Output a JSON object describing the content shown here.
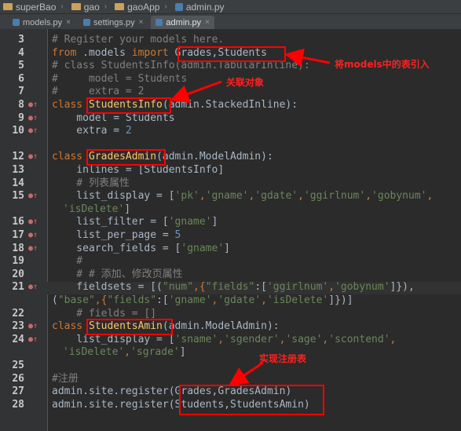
{
  "breadcrumb": [
    "superBao",
    "gao",
    "gaoApp",
    "admin.py"
  ],
  "tabs": [
    {
      "label": "models.py",
      "active": false
    },
    {
      "label": "settings.py",
      "active": false
    },
    {
      "label": "admin.py",
      "active": true
    }
  ],
  "annotations": {
    "import_models": "将models中的表引入",
    "related_object": "关联对象",
    "register_tables": "实现注册表"
  },
  "code": {
    "l3": "# Register your models here.",
    "l4a": "from",
    "l4b": " .models ",
    "l4c": "import",
    "l4d": " Grades,Students",
    "l5": "# class StudentsInfo(admin.TabularInline):",
    "l6": "#     model = Students",
    "l7": "#     extra = 2",
    "l8a": "class ",
    "l8b": "StudentsInfo",
    "l8c": "(admin.StackedInline):",
    "l9": "    model = Students",
    "l10a": "    extra = ",
    "l10b": "2",
    "l12a": "class ",
    "l12b": "GradesAdmin",
    "l12c": "(admin.ModelAdmin):",
    "l13": "    inlines = [StudentsInfo]",
    "l14": "    # 列表属性",
    "l15a": "    list_display = [",
    "l15b": "'pk'",
    "l15c": ",",
    "l15d": "'gname'",
    "l15e": ",",
    "l15f": "'gdate'",
    "l15g": ",",
    "l15h": "'ggirlnum'",
    "l15i": ",",
    "l15j": "'gobynum'",
    "l15k": ",",
    "l15w1": "'isDelete'",
    "l15w2": "]",
    "l16a": "    list_filter = [",
    "l16b": "'gname'",
    "l16c": "]",
    "l17a": "    list_per_page = ",
    "l17b": "5",
    "l18a": "    search_fields = [",
    "l18b": "'gname'",
    "l18c": "]",
    "l19": "    #",
    "l20": "    # # 添加、修改页属性",
    "l21a": "    fieldsets = [(",
    "l21b": "\"num\"",
    "l21c": ",{",
    "l21d": "\"fields\"",
    "l21e": ":[",
    "l21f": "'ggirlnum'",
    "l21g": ",",
    "l21h": "'gobynum'",
    "l21i": "]}),",
    "l21w1": "(",
    "l21w2": "\"base\"",
    "l21w3": ",{",
    "l21w4": "\"fields\"",
    "l21w5": ":[",
    "l21w6": "'gname'",
    "l21w7": ",",
    "l21w8": "'gdate'",
    "l21w9": ",",
    "l21w10": "'isDelete'",
    "l21w11": "]})]",
    "l22": "    # fields = []",
    "l23a": "class ",
    "l23b": "StudentsAmin",
    "l23c": "(admin.ModelAdmin):",
    "l24a": "    list_display = [",
    "l24b": "'sname'",
    "l24c": ",",
    "l24d": "'sgender'",
    "l24e": ",",
    "l24f": "'sage'",
    "l24g": ",",
    "l24h": "'scontend'",
    "l24i": ",",
    "l24w1": "'isDelete'",
    "l24w2": ",",
    "l24w3": "'sgrade'",
    "l24w4": "]",
    "l26": "#注册",
    "l27a": "admin.site.register(",
    "l27b": "Grades,GradesAdmin",
    "l27c": ")",
    "l28a": "admin.site.register(",
    "l28b": "Students,StudentsAmin",
    "l28c": ")"
  },
  "line_numbers": [
    "3",
    "4",
    "5",
    "6",
    "7",
    "8",
    "9",
    "10",
    "",
    "12",
    "13",
    "14",
    "15",
    "",
    "16",
    "17",
    "18",
    "19",
    "20",
    "21",
    "",
    "22",
    "23",
    "24",
    "",
    "25",
    "26",
    "27",
    "28"
  ]
}
